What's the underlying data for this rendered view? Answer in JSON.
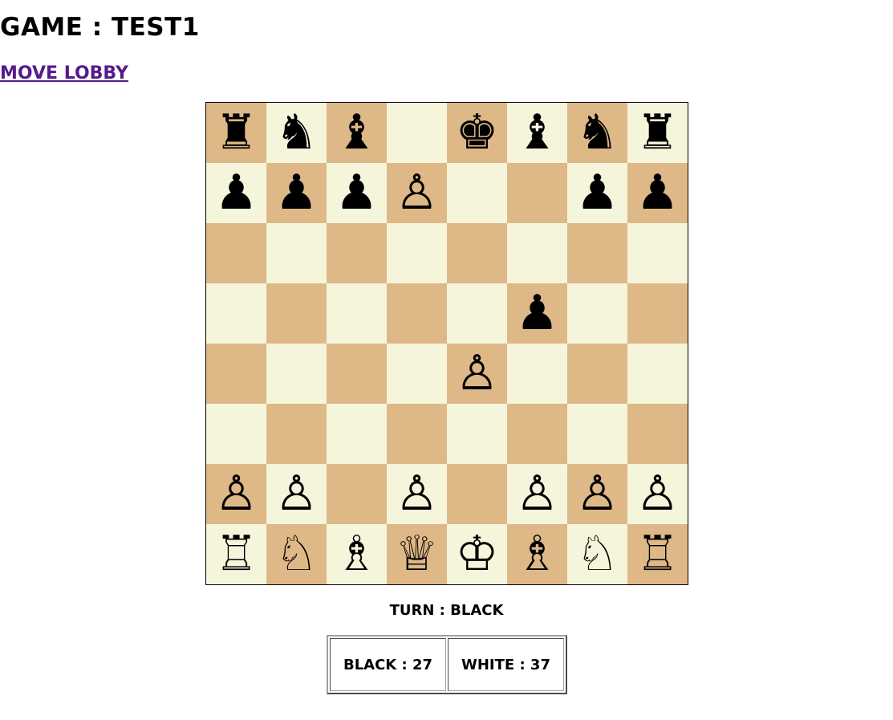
{
  "header": {
    "title": "GAME : TEST1",
    "lobby_link": "MOVE LOBBY"
  },
  "colors": {
    "light_square": "#f5f5dc",
    "dark_square": "#deb887",
    "link": "#551a8b"
  },
  "board": {
    "rows": [
      [
        "♜",
        "♞",
        "♝",
        "",
        "♚",
        "♝",
        "♞",
        "♜"
      ],
      [
        "♟",
        "♟",
        "♟",
        "♙",
        "",
        "",
        "♟",
        "♟"
      ],
      [
        "",
        "",
        "",
        "",
        "",
        "",
        "",
        ""
      ],
      [
        "",
        "",
        "",
        "",
        "",
        "♟",
        "",
        ""
      ],
      [
        "",
        "",
        "",
        "",
        "♙",
        "",
        "",
        ""
      ],
      [
        "",
        "",
        "",
        "",
        "",
        "",
        "",
        ""
      ],
      [
        "♙",
        "♙",
        "",
        "♙",
        "",
        "♙",
        "♙",
        "♙"
      ],
      [
        "♖",
        "♘",
        "♗",
        "♕",
        "♔",
        "♗",
        "♘",
        "♖"
      ]
    ]
  },
  "status": {
    "turn": "TURN : BLACK"
  },
  "scores": {
    "black": "BLACK : 27",
    "white": "WHITE : 37"
  }
}
